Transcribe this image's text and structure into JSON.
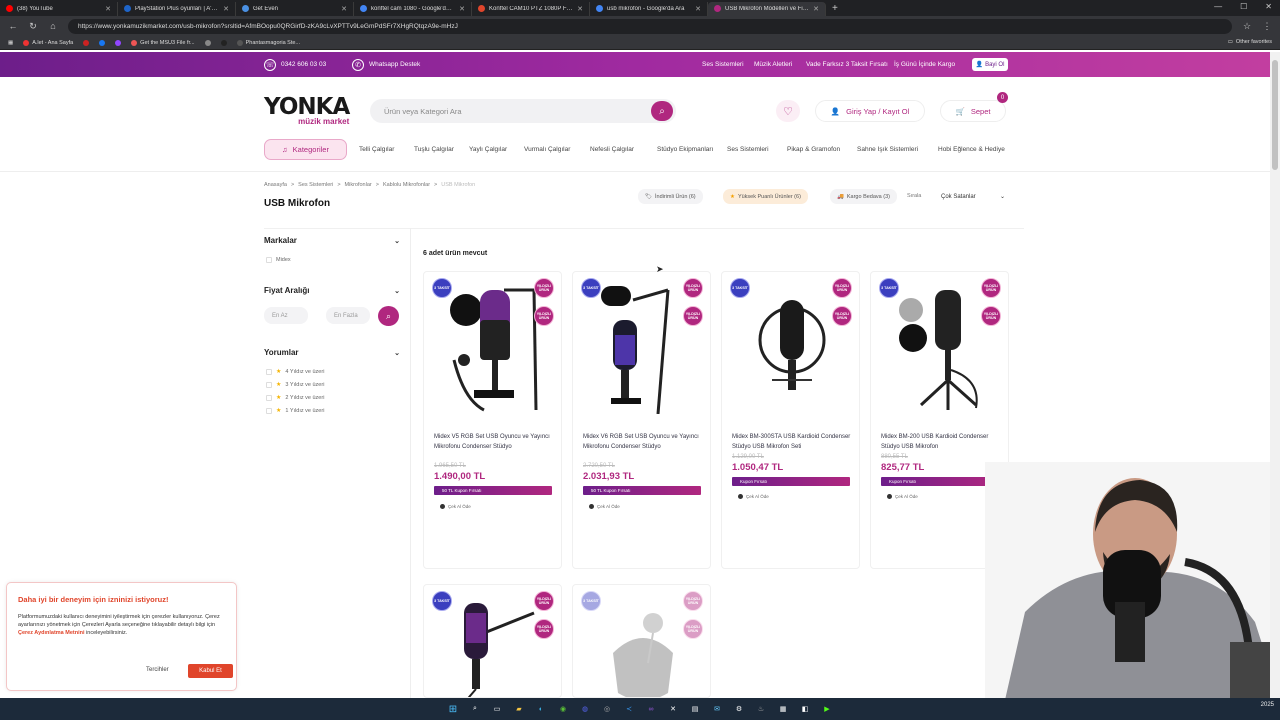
{
  "browser": {
    "tabs": [
      {
        "label": "(38) YouTube",
        "color": "#ff0000"
      },
      {
        "label": "PlayStation Plus oyunları | A'dan",
        "color": "#1e64c8"
      },
      {
        "label": "Get Even",
        "color": "#4a90e2"
      },
      {
        "label": "konftel cam 1080 - Google'da Ara",
        "color": "#4285f4"
      },
      {
        "label": "Konftel CAM10 PTZ 1080P Full H",
        "color": "#e0452b"
      },
      {
        "label": "usb mikrofon - Google'da Ara",
        "color": "#4285f4"
      },
      {
        "label": "USB Mikrofon Modelleri ve Fiyatl",
        "color": "#b0277f",
        "active": true
      }
    ],
    "new_tab": "+",
    "url": "https://www.yonkamuzikmarket.com/usb-mikrofon?srsltid=AfmBOopu0QRGirfD-zKA9cLvXPTTv9LeGmPdSFr7XHgRQtqzA9e-mHzJ",
    "bookmarks": [
      "A.let - Ana Sayfa",
      "Get the MSU3 File fr...",
      "Phantasmagoria Ste..."
    ],
    "other_bookmarks": "Other favorites"
  },
  "topbar": {
    "phone": "0342 606 03 03",
    "whatsapp": "Whatsapp Destek",
    "links": [
      "Ses Sistemleri",
      "Müzik Aletleri",
      "Vade Farksız 3 Taksit Fırsatı",
      "İş Günü İçinde Kargo"
    ],
    "dealer": "Bayi Ol"
  },
  "header": {
    "logo_main": "YONKA",
    "logo_sub": "müzik market",
    "search_placeholder": "Ürün veya Kategori Ara",
    "login": "Giriş Yap / Kayıt Ol",
    "cart": "Sepet",
    "cart_count": "0"
  },
  "nav": {
    "categories_button": "Kategoriler",
    "items": [
      "Telli Çalgılar",
      "Tuşlu Çalgılar",
      "Yaylı Çalgılar",
      "Vurmalı Çalgılar",
      "Nefesli Çalgılar",
      "Stüdyo Ekipmanları",
      "Ses Sistemleri",
      "Pikap & Gramofon",
      "Sahne Işık Sistemleri",
      "Hobi Eğlence & Hediye"
    ]
  },
  "breadcrumb": [
    "Anasayfa",
    ">",
    "Ses Sistemleri",
    ">",
    "Mikrofonlar",
    ">",
    "Kablolu Mikrofonlar",
    ">",
    "USB Mikrofon"
  ],
  "page_title": "USB Mikrofon",
  "filters": {
    "chips": [
      "İndirimli Ürün (6)",
      "Yüksek Puanlı Ürünler (6)",
      "Kargo Bedava (3)"
    ],
    "sort_label": "Sırala",
    "sort_value": "Çok Satanlar"
  },
  "sidebar": {
    "brands_title": "Markalar",
    "brands": [
      "Midex"
    ],
    "price_title": "Fiyat Aralığı",
    "price_min": "En Az",
    "price_max": "En Fazla",
    "reviews_title": "Yorumlar",
    "reviews": [
      "4 Yıldız ve üzeri",
      "3 Yıldız ve üzeri",
      "2 Yıldız ve üzeri",
      "1 Yıldız ve üzeri"
    ]
  },
  "result_count": "6 adet ürün mevcut",
  "badges": {
    "blue": "3 TAKSİT",
    "pink": "YILDIZLI ÜRÜN"
  },
  "products": [
    {
      "name": "Midex V5 RGB Set USB Oyuncu ve Yayıncı Mikrofonu Condenser Stüdyo",
      "old_price": "1.965,50 TL",
      "price": "1.490,00 TL",
      "coupon": "50 TL Kupon Fırsatı",
      "install": "Çek Al Öde"
    },
    {
      "name": "Midex V6 RGB Set USB Oyuncu ve Yayıncı Mikrofonu Condenser Stüdyo",
      "old_price": "2.720,50 TL",
      "price": "2.031,93 TL",
      "coupon": "50 TL Kupon Fırsatı",
      "install": "Çek Al Öde"
    },
    {
      "name": "Midex BM-300STA USB Kardioid Condenser Stüdyo USB Mikrofon Seti",
      "old_price": "1.129,00 TL",
      "price": "1.050,47 TL",
      "coupon": "Kupon Fırsatı",
      "install": "Çek Al Öde"
    },
    {
      "name": "Midex BM-200 USB Kardioid Condenser Stüdyo USB Mikrofon",
      "old_price": "880,55 TL",
      "price": "825,77 TL",
      "coupon": "Kupon Fırsatı",
      "install": "Çek Al Öde"
    }
  ],
  "cookie": {
    "title": "Daha iyi bir deneyim için izninizi istiyoruz!",
    "body": "Platformumuzdaki kullanıcı deneyimini iyileştirmek için çerezler kullanıyoruz. Çerez ayarlarınızı yönetmek için Çerezleri Ayarla seçeneğine tıklayabilir detaylı bilgi için",
    "link": "Çerez Aydınlatma Metnini",
    "body_end": "inceleyebilirsiniz.",
    "preferences": "Tercihler",
    "accept": "Kabul Et"
  },
  "taskbar": {
    "time": "",
    "date": "2025"
  }
}
